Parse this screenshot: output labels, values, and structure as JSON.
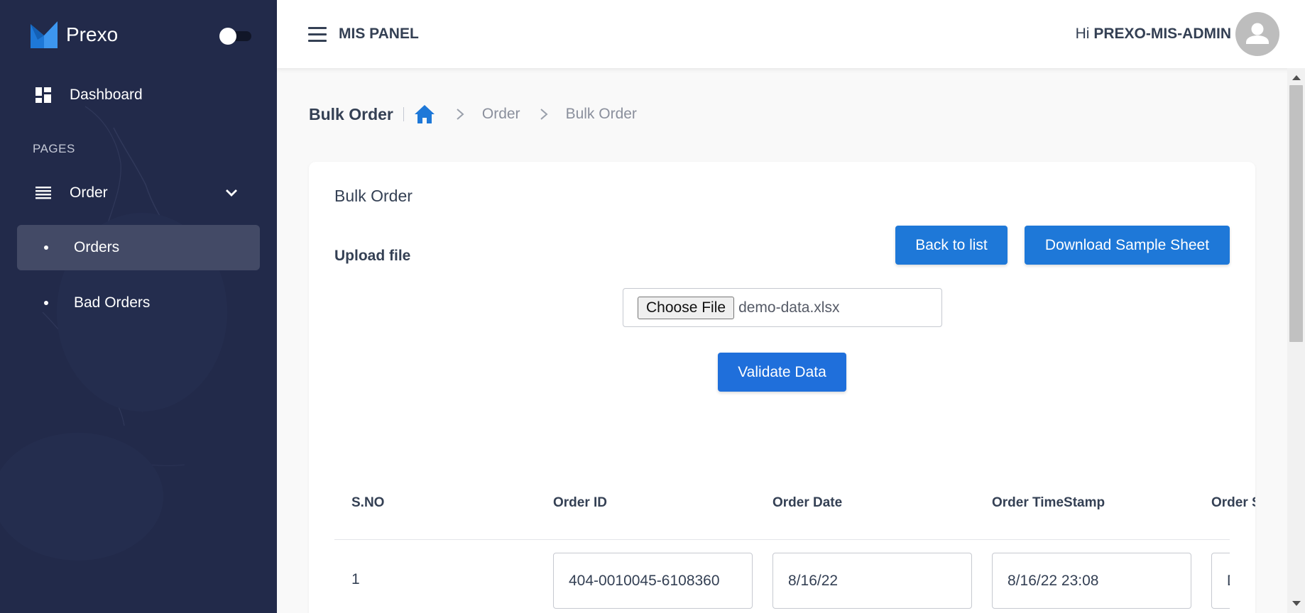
{
  "brand": {
    "name": "Prexo"
  },
  "sidebar": {
    "dashboard_label": "Dashboard",
    "section_title": "PAGES",
    "order_label": "Order",
    "items": [
      {
        "label": "Orders",
        "active": true
      },
      {
        "label": "Bad Orders",
        "active": false
      }
    ]
  },
  "header": {
    "panel_title": "MIS PANEL",
    "greeting_prefix": "Hi",
    "username": "PREXO-MIS-ADMIN"
  },
  "breadcrumb": {
    "title": "Bulk Order",
    "items": [
      "Order",
      "Bulk Order"
    ]
  },
  "card": {
    "title": "Bulk Order",
    "upload_label": "Upload file",
    "back_button": "Back to list",
    "download_button": "Download Sample Sheet",
    "file_button": "Choose File",
    "file_name": "demo-data.xlsx",
    "validate_button": "Validate Data"
  },
  "table": {
    "columns": [
      "S.NO",
      "Order ID",
      "Order Date",
      "Order TimeStamp",
      "Order Status"
    ],
    "rows": [
      {
        "sno": "1",
        "order_id": "404-0010045-6108360",
        "order_date": "8/16/22",
        "order_timestamp": "8/16/22 23:08",
        "order_status": "Delivered"
      }
    ]
  },
  "colors": {
    "sidebar_bg": "#222a4a",
    "accent": "#1e78d8",
    "active_item": "#434a66"
  }
}
